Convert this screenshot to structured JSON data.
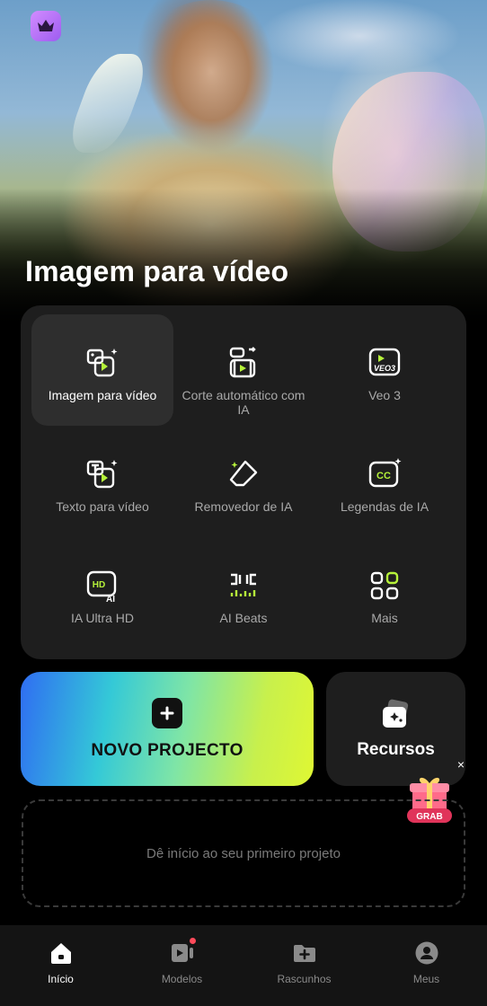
{
  "hero": {
    "title": "Imagem para vídeo",
    "crown_icon": "crown-icon"
  },
  "tools": [
    {
      "label": "Imagem para vídeo",
      "icon": "image-to-video-icon",
      "active": true
    },
    {
      "label": "Corte automático com IA",
      "icon": "auto-cut-icon",
      "active": false
    },
    {
      "label": "Veo 3",
      "icon": "veo3-icon",
      "active": false
    },
    {
      "label": "Texto para vídeo",
      "icon": "text-to-video-icon",
      "active": false
    },
    {
      "label": "Removedor de IA",
      "icon": "eraser-icon",
      "active": false
    },
    {
      "label": "Legendas de IA",
      "icon": "captions-icon",
      "active": false
    },
    {
      "label": "IA Ultra HD",
      "icon": "hd-ai-icon",
      "active": false
    },
    {
      "label": "AI Beats",
      "icon": "beats-icon",
      "active": false
    },
    {
      "label": "Mais",
      "icon": "grid-icon",
      "active": false
    }
  ],
  "actions": {
    "new_project_label": "NOVO PROJECTO",
    "resources_label": "Recursos",
    "grab_badge": "GRAB",
    "close_symbol": "×"
  },
  "empty_state": {
    "text": "Dê início ao seu primeiro projeto"
  },
  "bottom_nav": [
    {
      "label": "Início",
      "icon": "home-icon",
      "active": true
    },
    {
      "label": "Modelos",
      "icon": "templates-icon",
      "active": false,
      "notification": true
    },
    {
      "label": "Rascunhos",
      "icon": "drafts-folder-icon",
      "active": false
    },
    {
      "label": "Meus",
      "icon": "profile-icon",
      "active": false
    }
  ],
  "colors": {
    "accent_green": "#b6f23a",
    "panel_bg": "#1e1e1e",
    "notification": "#ff4a5a"
  }
}
